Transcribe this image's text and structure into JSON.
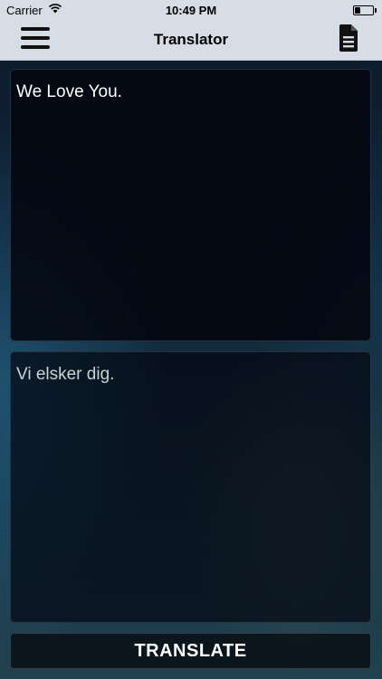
{
  "status_bar": {
    "carrier": "Carrier",
    "time": "10:49 PM",
    "wifi_icon": "wifi-icon",
    "battery_icon": "battery-icon"
  },
  "nav": {
    "title": "Translator",
    "menu_icon": "hamburger-menu-icon",
    "document_icon": "document-icon"
  },
  "source": {
    "text": "We Love You."
  },
  "output": {
    "text": "Vi elsker dig."
  },
  "actions": {
    "translate_label": "TRANSLATE"
  },
  "colors": {
    "nav_background": "#d7dde4",
    "panel_background": "#03070f",
    "button_text": "#ffffff"
  }
}
